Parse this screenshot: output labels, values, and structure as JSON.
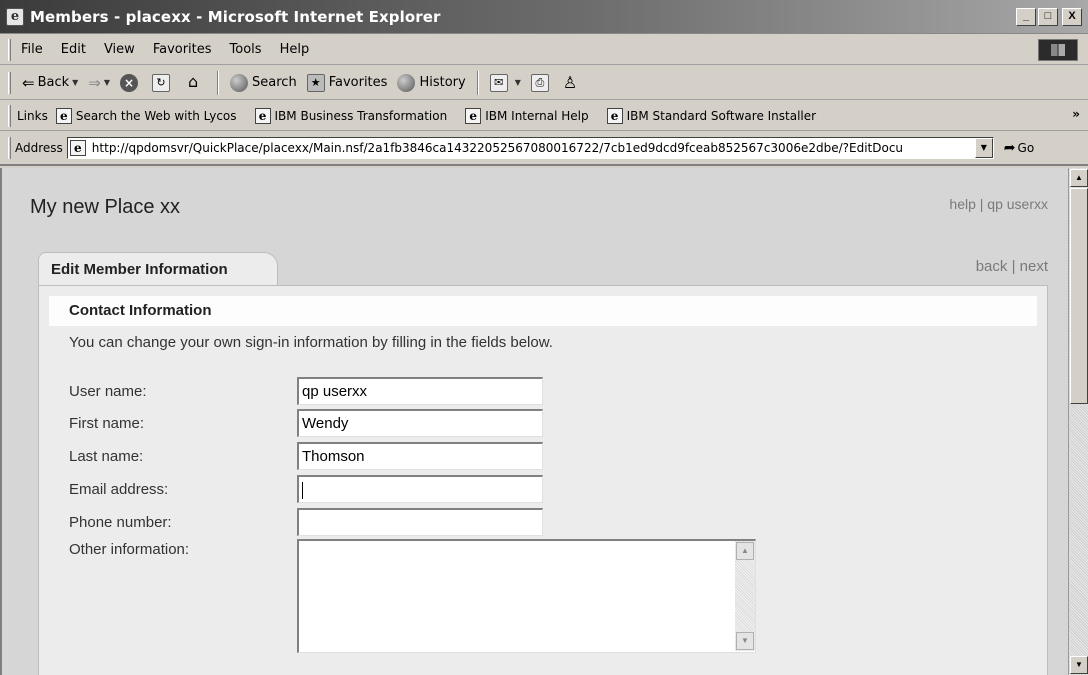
{
  "window": {
    "title": "Members - placexx - Microsoft Internet Explorer",
    "buttons": [
      "_",
      "□",
      "X"
    ]
  },
  "menu": [
    "File",
    "Edit",
    "View",
    "Favorites",
    "Tools",
    "Help"
  ],
  "toolbar": {
    "back": "Back",
    "search": "Search",
    "favorites": "Favorites",
    "history": "History"
  },
  "links": {
    "label": "Links",
    "items": [
      "Search the Web with Lycos",
      "IBM Business Transformation",
      "IBM Internal Help",
      "IBM Standard Software Installer"
    ],
    "more": "»"
  },
  "address": {
    "label": "Address",
    "url": "http://qpdomsvr/QuickPlace/placexx/Main.nsf/2a1fb3846ca14322052567080016722/7cb1ed9dcd9fceab852567c3006e2dbe/?EditDocu",
    "go": "Go"
  },
  "page": {
    "place_title": "My new Place xx",
    "help": "help",
    "user_link": "qp userxx",
    "separator": "|",
    "tab": "Edit Member Information",
    "back": "back",
    "next": "next",
    "section": "Contact Information",
    "intro": "You can change your own sign-in information by filling in the fields below."
  },
  "form": {
    "user_name_label": "User name:",
    "user_name": "qp userxx",
    "first_name_label": "First name:",
    "first_name": "Wendy",
    "last_name_label": "Last name:",
    "last_name": "Thomson",
    "email_label": "Email address:",
    "email": "",
    "phone_label": "Phone number:",
    "phone": "",
    "other_label": "Other information:",
    "other": ""
  }
}
